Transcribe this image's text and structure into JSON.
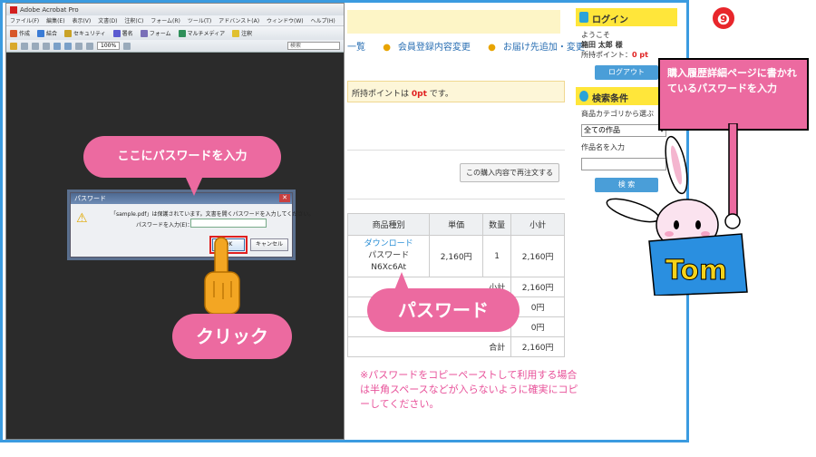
{
  "step_badge": "❾",
  "webpage": {
    "nav_links": [
      "一覧",
      "会員登録内容変更",
      "お届け先追加・変更"
    ],
    "points_text": "所持ポイントは",
    "points_value": "0pt",
    "points_suffix": "です。",
    "reorder_button": "この購入内容で再注文する",
    "table": {
      "headers": [
        "商品種別",
        "単価",
        "数量",
        "小計"
      ],
      "product_type_link": "ダウンロード",
      "password_label": "パスワード",
      "password_value": "N6Xc6At",
      "unit_price": "2,160円",
      "quantity": "1",
      "line_subtotal": "2,160円",
      "subtotal_label": "小計",
      "subtotal_value": "2,160円",
      "row2_value": "0円",
      "row3_value": "0円",
      "total_label": "合計",
      "total_value": "2,160円"
    },
    "note": "※パスワードをコピーペーストして利用する場合は半角スペースなどが入らないように確実にコピーしてください。"
  },
  "sidebar": {
    "login_title": "ログイン",
    "welcome": "ようこそ",
    "user_name": "箱田 太郎 様",
    "points_label": "所持ポイント：",
    "points_value": "0 pt",
    "logout_button": "ログアウト",
    "search_title": "検索条件",
    "category_label": "商品カテゴリから選ぶ",
    "category_value": "全ての作品",
    "name_label": "作品名を入力",
    "search_button": "検 索"
  },
  "acrobat": {
    "title": "Adobe Acrobat Pro",
    "menu": [
      "ファイル(F)",
      "編集(E)",
      "表示(V)",
      "文書(D)",
      "注釈(C)",
      "フォーム(R)",
      "ツール(T)",
      "アドバンスト(A)",
      "ウィンドウ(W)",
      "ヘルプ(H)"
    ],
    "toolbar": [
      "作成",
      "結合",
      "セキュリティ",
      "署名",
      "フォーム",
      "マルチメディア",
      "注釈"
    ],
    "zoom": "100%",
    "search_placeholder": "検索"
  },
  "dialog": {
    "title": "パスワード",
    "message": "「sample.pdf」は保護されています。文書を開くパスワードを入力してください。",
    "field_label": "パスワードを入力(E)：",
    "ok": "OK",
    "cancel": "キャンセル"
  },
  "callouts": {
    "enter_password": "ここにパスワードを入力",
    "click": "クリック",
    "password": "パスワード",
    "history_note": "購入履歴詳細ページに書かれているパスワードを入力"
  },
  "mascot_sign": "Tom",
  "colors": {
    "accent_pink": "#ec6aa0",
    "frame_blue": "#3b9be0",
    "highlight_red": "#e02020",
    "badge_red": "#e8262b"
  }
}
